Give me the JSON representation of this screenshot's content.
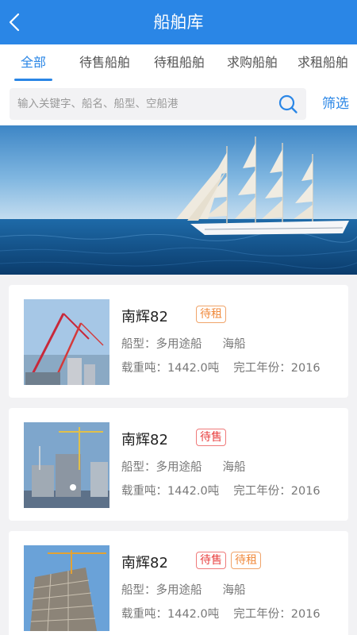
{
  "header": {
    "title": "船舶库"
  },
  "tabs": [
    {
      "label": "全部",
      "active": true
    },
    {
      "label": "待售船舶",
      "active": false
    },
    {
      "label": "待租船舶",
      "active": false
    },
    {
      "label": "求购船舶",
      "active": false
    },
    {
      "label": "求租船舶",
      "active": false
    }
  ],
  "search": {
    "placeholder": "输入关键字、船名、船型、空船港",
    "value": ""
  },
  "filter_label": "筛选",
  "banner": {
    "image": "sailing-ship-on-sea"
  },
  "ships": [
    {
      "name": "南辉82",
      "badges": [
        {
          "label": "待租",
          "type": "rent"
        }
      ],
      "type_label": "船型：",
      "type_value": "多用途船",
      "category": "海船",
      "dwt_label": "载重吨：",
      "dwt_value": "1442.0吨",
      "year_label": "完工年份：",
      "year_value": "2016",
      "image": "construction-cranes"
    },
    {
      "name": "南辉82",
      "badges": [
        {
          "label": "待售",
          "type": "sale"
        }
      ],
      "type_label": "船型：",
      "type_value": "多用途船",
      "category": "海船",
      "dwt_label": "载重吨：",
      "dwt_value": "1442.0吨",
      "year_label": "完工年份：",
      "year_value": "2016",
      "image": "construction-site"
    },
    {
      "name": "南辉82",
      "badges": [
        {
          "label": "待售",
          "type": "sale"
        },
        {
          "label": "待租",
          "type": "rent"
        }
      ],
      "type_label": "船型：",
      "type_value": "多用途船",
      "category": "海船",
      "dwt_label": "载重吨：",
      "dwt_value": "1442.0吨",
      "year_label": "完工年份：",
      "year_value": "2016",
      "image": "building-under-construction"
    }
  ],
  "colors": {
    "primary": "#2a86e6",
    "rent_badge": "#f08a3c",
    "sale_badge": "#e84040",
    "background": "#f2f2f4"
  }
}
